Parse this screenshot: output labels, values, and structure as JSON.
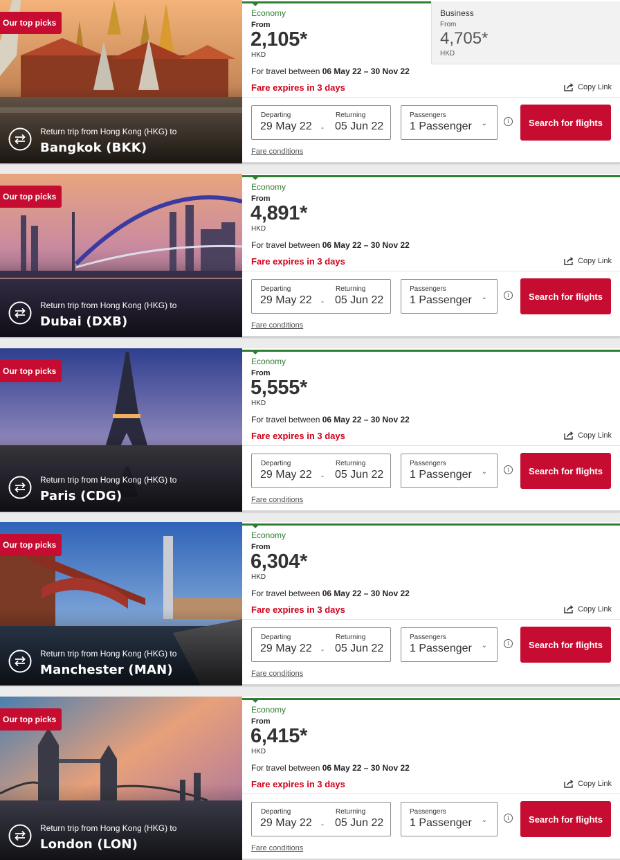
{
  "cards": [
    {
      "badge": "Our top picks",
      "trip_label": "Return trip from Hong Kong (HKG) to",
      "destination": "Bangkok (BKK)",
      "cabin": "Economy",
      "from_label": "From",
      "price": "2,105*",
      "currency": "HKD",
      "alt_cabin": {
        "cabin": "Business",
        "from_label": "From",
        "price": "4,705*",
        "currency": "HKD"
      },
      "travel_prefix": "For travel between",
      "travel_range": "06 May 22 – 30 Nov 22",
      "expires": "Fare expires in 3 days",
      "copy_link": "Copy Link",
      "departing_label": "Departing",
      "departing": "29 May 22",
      "returning_label": "Returning",
      "returning": "05 Jun 22",
      "passengers_label": "Passengers",
      "passengers": "1 Passenger",
      "search_label": "Search for flights",
      "fare_conditions": "Fare conditions"
    },
    {
      "badge": "Our top picks",
      "trip_label": "Return trip from Hong Kong (HKG) to",
      "destination": "Dubai (DXB)",
      "cabin": "Economy",
      "from_label": "From",
      "price": "4,891*",
      "currency": "HKD",
      "travel_prefix": "For travel between",
      "travel_range": "06 May 22 – 30 Nov 22",
      "expires": "Fare expires in 3 days",
      "copy_link": "Copy Link",
      "departing_label": "Departing",
      "departing": "29 May 22",
      "returning_label": "Returning",
      "returning": "05 Jun 22",
      "passengers_label": "Passengers",
      "passengers": "1 Passenger",
      "search_label": "Search for flights",
      "fare_conditions": "Fare conditions"
    },
    {
      "badge": "Our top picks",
      "trip_label": "Return trip from Hong Kong (HKG) to",
      "destination": "Paris (CDG)",
      "cabin": "Economy",
      "from_label": "From",
      "price": "5,555*",
      "currency": "HKD",
      "travel_prefix": "For travel between",
      "travel_range": "06 May 22 – 30 Nov 22",
      "expires": "Fare expires in 3 days",
      "copy_link": "Copy Link",
      "departing_label": "Departing",
      "departing": "29 May 22",
      "returning_label": "Returning",
      "returning": "05 Jun 22",
      "passengers_label": "Passengers",
      "passengers": "1 Passenger",
      "search_label": "Search for flights",
      "fare_conditions": "Fare conditions"
    },
    {
      "badge": "Our top picks",
      "trip_label": "Return trip from Hong Kong (HKG) to",
      "destination": "Manchester (MAN)",
      "cabin": "Economy",
      "from_label": "From",
      "price": "6,304*",
      "currency": "HKD",
      "travel_prefix": "For travel between",
      "travel_range": "06 May 22 – 30 Nov 22",
      "expires": "Fare expires in 3 days",
      "copy_link": "Copy Link",
      "departing_label": "Departing",
      "departing": "29 May 22",
      "returning_label": "Returning",
      "returning": "05 Jun 22",
      "passengers_label": "Passengers",
      "passengers": "1 Passenger",
      "search_label": "Search for flights",
      "fare_conditions": "Fare conditions"
    },
    {
      "badge": "Our top picks",
      "trip_label": "Return trip from Hong Kong (HKG) to",
      "destination": "London (LON)",
      "cabin": "Economy",
      "from_label": "From",
      "price": "6,415*",
      "currency": "HKD",
      "travel_prefix": "For travel between",
      "travel_range": "06 May 22 – 30 Nov 22",
      "expires": "Fare expires in 3 days",
      "copy_link": "Copy Link",
      "departing_label": "Departing",
      "departing": "29 May 22",
      "returning_label": "Returning",
      "returning": "05 Jun 22",
      "passengers_label": "Passengers",
      "passengers": "1 Passenger",
      "search_label": "Search for flights",
      "fare_conditions": "Fare conditions"
    }
  ],
  "colors": {
    "brand_red": "#c60c30",
    "economy_green": "#2e7d32",
    "expires_red": "#d0021b"
  },
  "icons": {
    "trip": "round-trip-arrows-icon",
    "share": "share-icon",
    "info": "info-icon",
    "dropdown": "chevron-down-icon"
  }
}
